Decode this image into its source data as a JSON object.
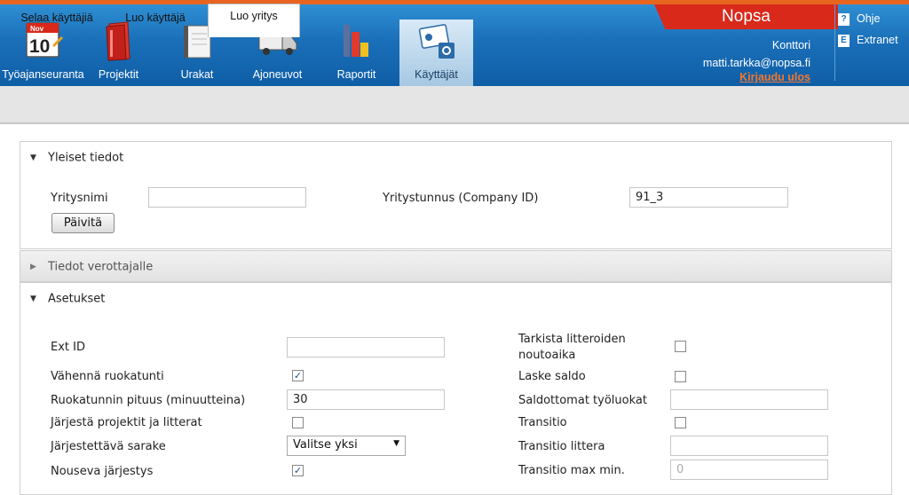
{
  "header": {
    "nav": [
      {
        "label": "Työajanseuranta",
        "icon": "calendar-icon"
      },
      {
        "label": "Projektit",
        "icon": "folder-icon"
      },
      {
        "label": "Urakat",
        "icon": "notebook-icon"
      },
      {
        "label": "Ajoneuvot",
        "icon": "truck-icon"
      },
      {
        "label": "Raportit",
        "icon": "report-icon"
      },
      {
        "label": "Käyttäjät",
        "icon": "user-card-icon",
        "active": true
      }
    ],
    "calendar_month": "Nov",
    "calendar_day": "10",
    "brand": "Nopsa",
    "office": "Konttori",
    "email": "matti.tarkka@nopsa.fi",
    "logout": "Kirjaudu ulos",
    "help": "Ohje",
    "help_icon": "?",
    "extranet": "Extranet",
    "extranet_icon": "E",
    "colors": {
      "bar": "#1a6fb8",
      "brand": "#d8291b",
      "accent": "#e8651f",
      "logout": "#f5782b"
    }
  },
  "subnav": {
    "tabs": [
      {
        "label": "Selaa käyttäjiä"
      },
      {
        "label": "Luo käyttäjä"
      },
      {
        "label": "Luo yritys",
        "active": true
      }
    ]
  },
  "general": {
    "title": "Yleiset tiedot",
    "company_name_label": "Yritysnimi",
    "company_name_value": "",
    "company_id_label": "Yritystunnus (Company ID)",
    "company_id_value": "91_3",
    "update_button": "Päivitä"
  },
  "tax": {
    "title": "Tiedot verottajalle"
  },
  "settings": {
    "title": "Asetukset",
    "ext_id_label": "Ext ID",
    "ext_id_value": "",
    "lunch_label": "Vähennä ruokatunti",
    "lunch_checked": true,
    "lunch_length_label": "Ruokatunnin pituus (minuutteina)",
    "lunch_length_value": "30",
    "sort_label": "Järjestä projektit ja litterat",
    "sort_checked": false,
    "sort_column_label": "Järjestettävä sarake",
    "sort_column_value": "Valitse yksi",
    "ascending_label": "Nouseva järjestys",
    "ascending_checked": true,
    "pickup_label_1": "Tarkista litteroiden",
    "pickup_label_2": "noutoaika",
    "pickup_checked": false,
    "balance_label": "Laske saldo",
    "balance_checked": false,
    "no_balance_label": "Saldottomat työluokat",
    "no_balance_value": "",
    "transit_label": "Transitio",
    "transit_checked": false,
    "transit_item_label": "Transitio littera",
    "transit_item_value": "",
    "transit_max_label": "Transitio max min.",
    "transit_max_value": "0"
  }
}
